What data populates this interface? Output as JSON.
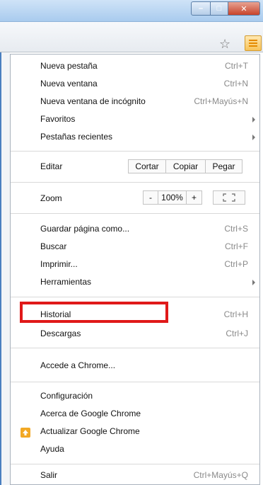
{
  "window": {
    "minimize_glyph": "–",
    "maximize_glyph": "□",
    "close_glyph": "✕"
  },
  "toolbar": {
    "star_glyph": "☆"
  },
  "menu": {
    "items": [
      {
        "label": "Nueva pestaña",
        "shortcut": "Ctrl+T"
      },
      {
        "label": "Nueva ventana",
        "shortcut": "Ctrl+N"
      },
      {
        "label": "Nueva ventana de incógnito",
        "shortcut": "Ctrl+Mayús+N"
      },
      {
        "label": "Favoritos",
        "shortcut": ""
      },
      {
        "label": "Pestañas recientes",
        "shortcut": ""
      }
    ],
    "edit": {
      "label": "Editar",
      "cut": "Cortar",
      "copy": "Copiar",
      "paste": "Pegar"
    },
    "zoom": {
      "label": "Zoom",
      "minus": "-",
      "value": "100%",
      "plus": "+"
    },
    "items2": [
      {
        "label": "Guardar página como...",
        "shortcut": "Ctrl+S"
      },
      {
        "label": "Buscar",
        "shortcut": "Ctrl+F"
      },
      {
        "label": "Imprimir...",
        "shortcut": "Ctrl+P"
      },
      {
        "label": "Herramientas",
        "shortcut": ""
      }
    ],
    "items3": [
      {
        "label": "Historial",
        "shortcut": "Ctrl+H"
      },
      {
        "label": "Descargas",
        "shortcut": "Ctrl+J"
      }
    ],
    "signin": {
      "label": "Accede a Chrome..."
    },
    "items4": [
      {
        "label": "Configuración"
      },
      {
        "label": "Acerca de Google Chrome"
      },
      {
        "label": "Actualizar Google Chrome"
      },
      {
        "label": "Ayuda"
      }
    ],
    "exit": {
      "label": "Salir",
      "shortcut": "Ctrl+Mayús+Q"
    }
  },
  "colors": {
    "highlight": "#e01919",
    "menu_accent": "#f7c35a",
    "update_icon": "#f2a824"
  }
}
